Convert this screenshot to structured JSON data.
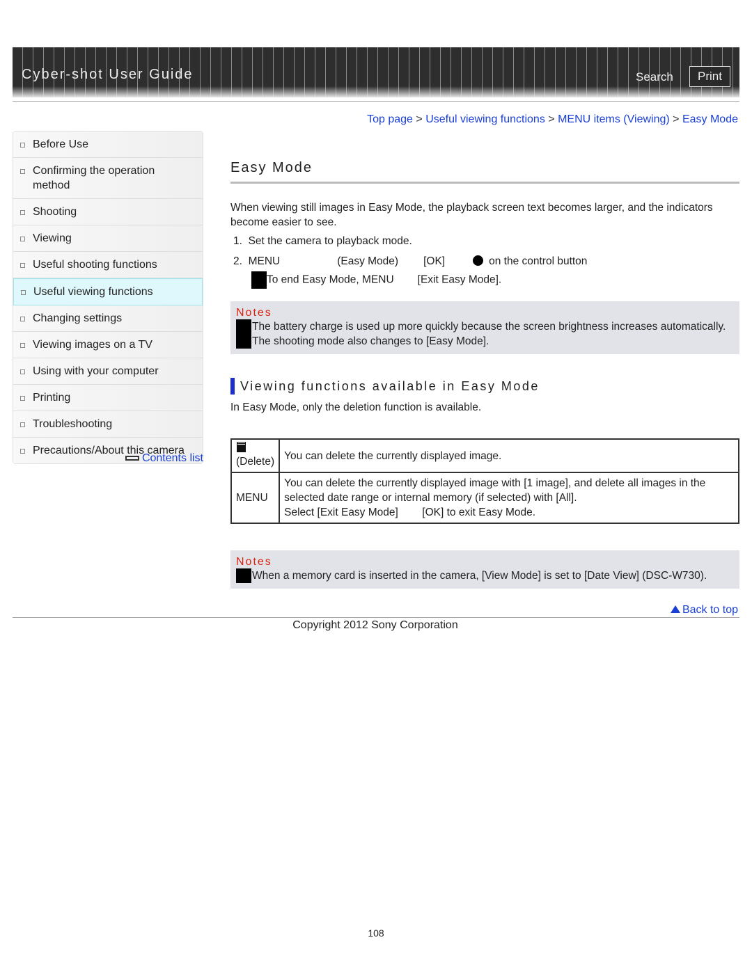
{
  "header": {
    "title": "Cyber-shot User Guide",
    "search": "Search",
    "print": "Print"
  },
  "breadcrumb": [
    "Top page",
    "Useful viewing functions",
    "MENU items (Viewing)",
    "Easy Mode"
  ],
  "breadcrumb_sep": ">",
  "sidebar": {
    "items": [
      "Before Use",
      "Confirming the operation method",
      "Shooting",
      "Viewing",
      "Useful shooting functions",
      "Useful viewing functions",
      "Changing settings",
      "Viewing images on a TV",
      "Using with your computer",
      "Printing",
      "Troubleshooting",
      "Precautions/About this camera"
    ],
    "selected": "Useful viewing functions",
    "contents_list": "Contents list"
  },
  "main": {
    "title": "Easy Mode",
    "intro": "When viewing still images in Easy Mode, the playback screen text becomes larger, and the indicators become easier to see.",
    "steps": [
      {
        "num": "1.",
        "text": "Set the camera to playback mode."
      },
      {
        "num": "2.",
        "parts": [
          "MENU",
          "(Easy Mode)",
          "[OK]",
          "on the control button"
        ]
      }
    ],
    "step_note_parts": [
      "To end Easy Mode, MENU",
      "[Exit Easy Mode]."
    ],
    "notes1": {
      "label": "Notes",
      "lines": [
        "The battery charge is used up more quickly because the screen brightness increases automatically.",
        "The shooting mode also changes to [Easy Mode]."
      ]
    },
    "section_title": "Viewing functions available in Easy Mode",
    "section_intro": "In Easy Mode, only the deletion function is available.",
    "table": [
      {
        "key": "(Delete)",
        "icon": "trash-icon",
        "lines": [
          "You can delete the currently displayed image."
        ]
      },
      {
        "key": "MENU",
        "lines": [
          "You can delete the currently displayed image with [1 image], and delete all images in the selected date range or internal memory (if selected) with [All].",
          "Select [Exit Easy Mode]        [OK] to exit Easy Mode."
        ]
      }
    ],
    "notes2": {
      "label": "Notes",
      "lines": [
        "When a memory card is inserted in the camera, [View Mode] is set to [Date View] (DSC-W730)."
      ]
    }
  },
  "back_to_top": "Back to top",
  "copyright": "Copyright 2012 Sony Corporation",
  "page_number": "108"
}
